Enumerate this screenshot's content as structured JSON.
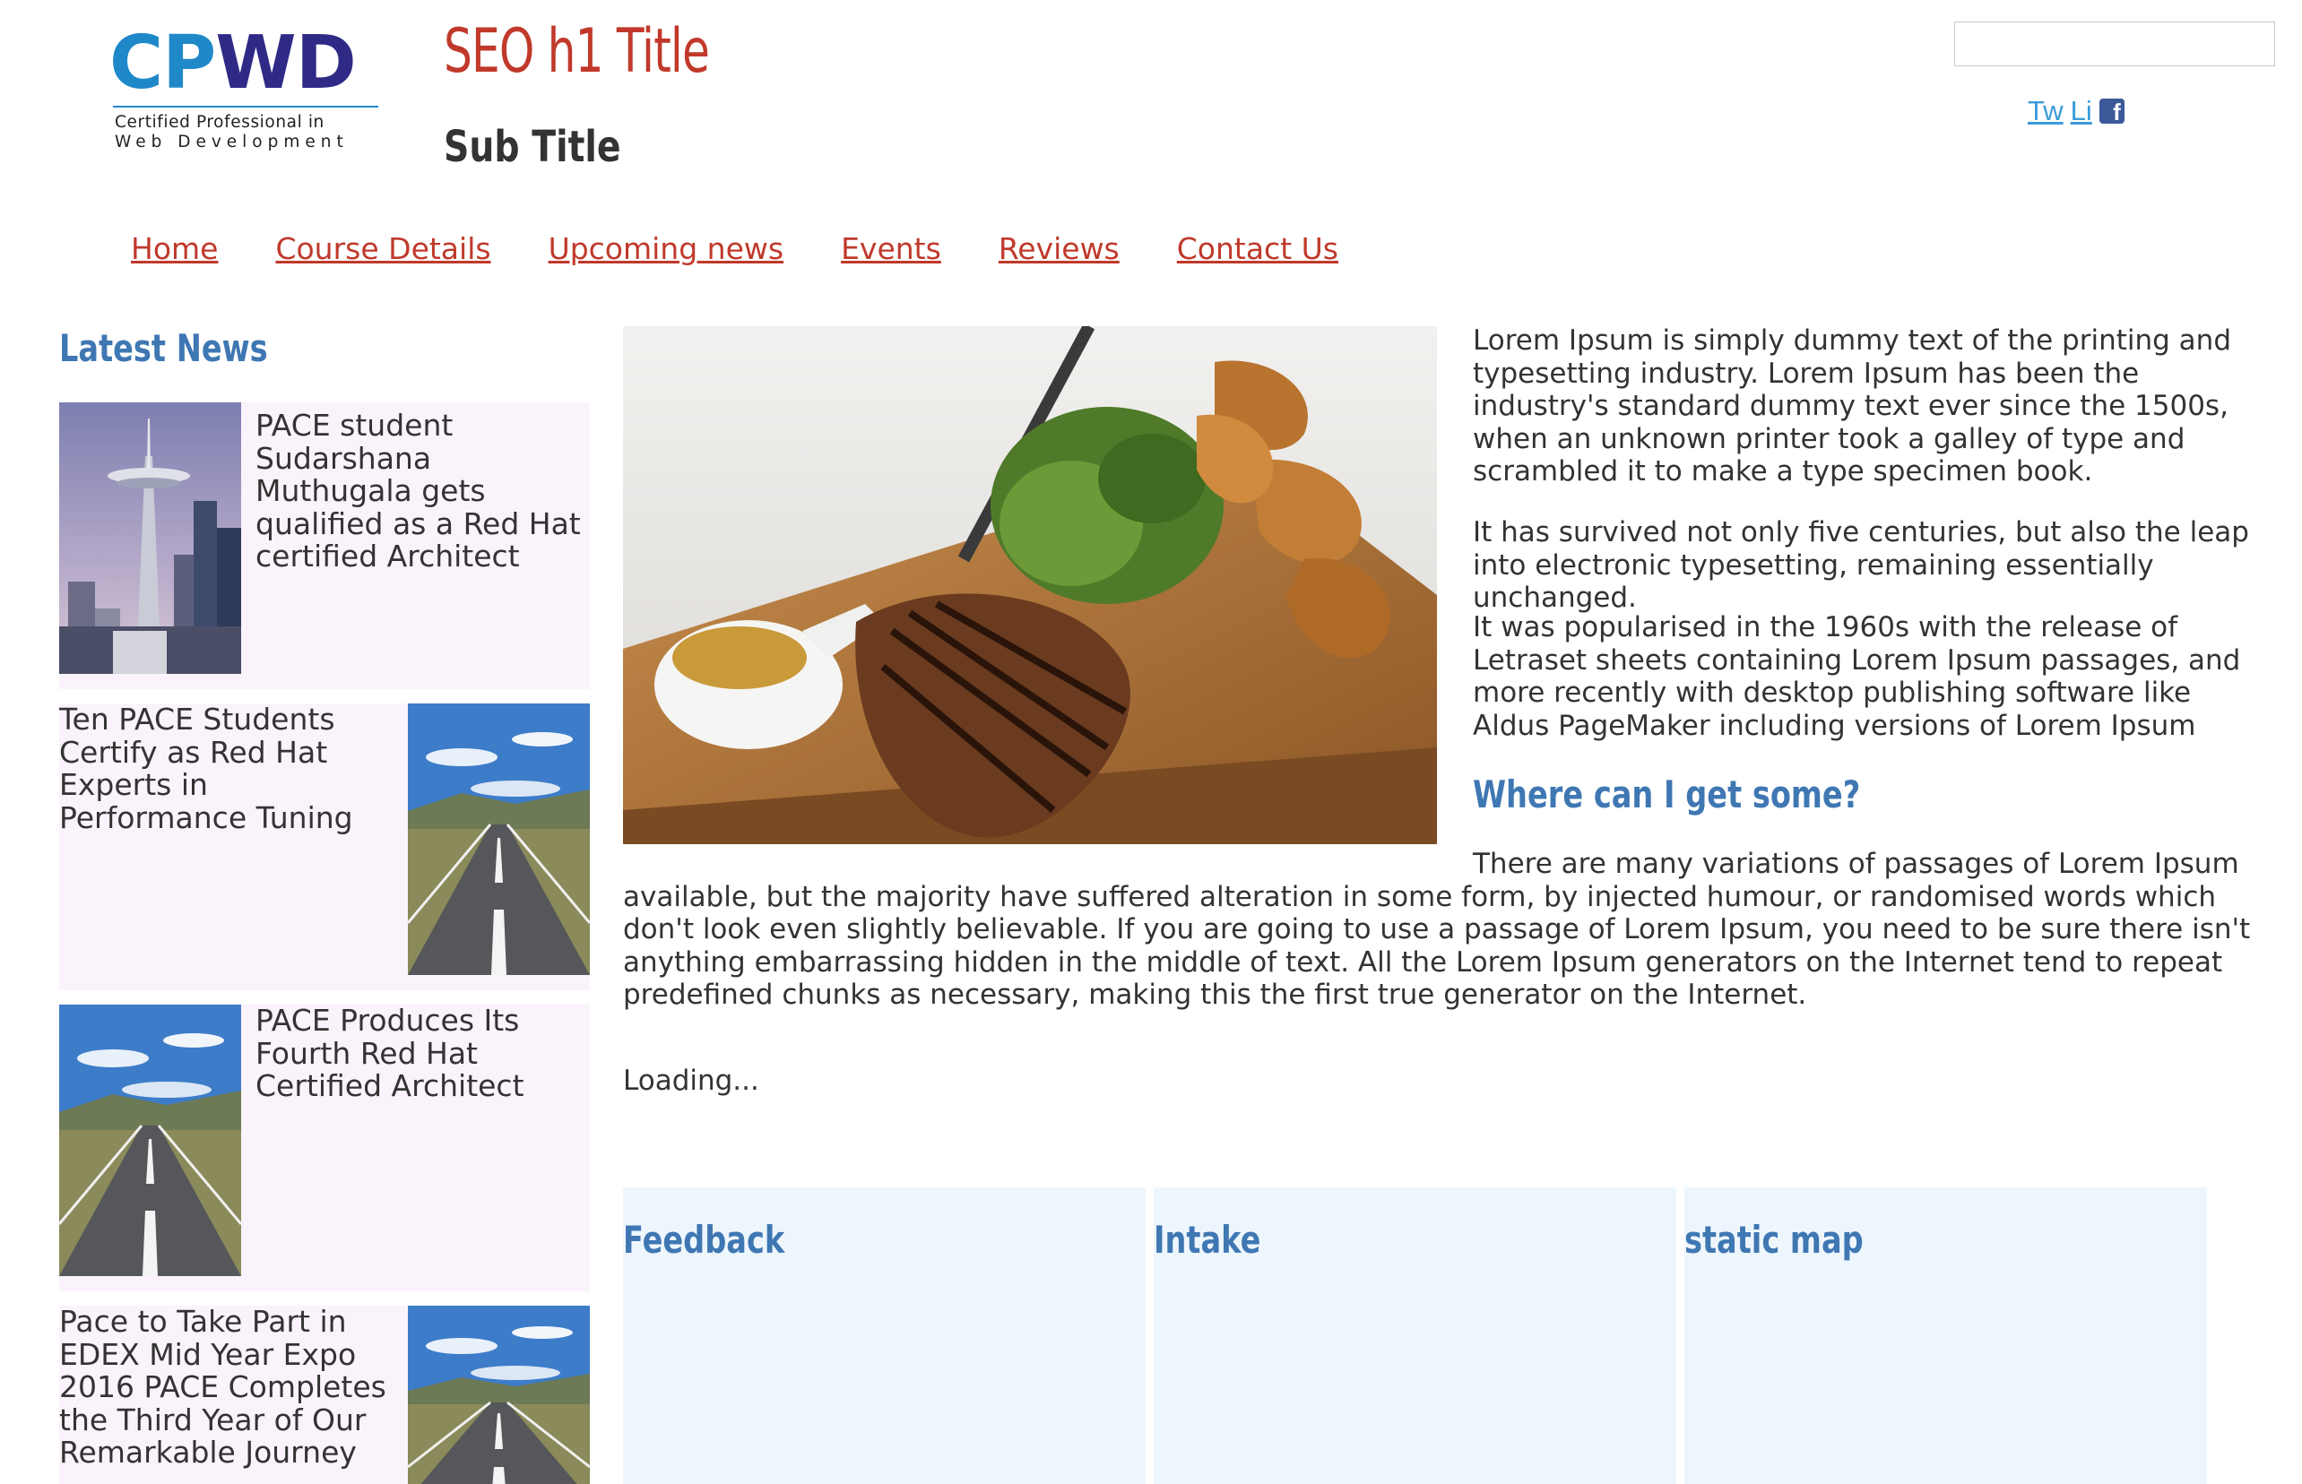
{
  "header": {
    "logo": {
      "part1": "CP",
      "part2": "WD",
      "tag_line1": "Certified Professional in",
      "tag_line2": "Web Development"
    },
    "h1_title": "SEO h1 Title",
    "sub_title": "Sub Title",
    "search": {
      "value": "",
      "placeholder": ""
    },
    "social": {
      "twitter": "Tw",
      "linkedin": "Li",
      "facebook": "f"
    }
  },
  "nav": [
    {
      "label": "Home"
    },
    {
      "label": "Course Details"
    },
    {
      "label": "Upcoming news"
    },
    {
      "label": "Events"
    },
    {
      "label": "Reviews"
    },
    {
      "label": "Contact Us"
    }
  ],
  "latest_news": {
    "heading": "Latest News",
    "items": [
      {
        "text": "PACE student Sudarshana Muthugala gets qualified as a Red Hat certified Architect",
        "image": "space-needle-photo"
      },
      {
        "text": "Ten PACE Students Certify as Red Hat Experts in Performance Tuning",
        "image": "road-photo"
      },
      {
        "text": "PACE Produces Its Fourth Red Hat Certified Architect",
        "image": "road-photo"
      },
      {
        "text": "Pace to Take Part in EDEX Mid Year Expo 2016 PACE Completes the Third Year of Our Remarkable Journey",
        "image": "road-photo"
      }
    ]
  },
  "main": {
    "hero_image": "steak-dinner-photo",
    "paragraphs": [
      "Lorem Ipsum is simply dummy text of the printing and typesetting industry. Lorem Ipsum has been the industry's standard dummy text ever since the 1500s, when an unknown printer took a galley of type and scrambled it to make a type specimen book.",
      "It has survived not only five centuries, but also the leap into electronic typesetting, remaining essentially unchanged.",
      "It was popularised in the 1960s with the release of Letraset sheets containing Lorem Ipsum passages, and more recently with desktop publishing software like Aldus PageMaker including versions of Lorem Ipsum"
    ],
    "where_heading": "Where can I get some?",
    "where_text": "There are many variations of passages of Lorem Ipsum available, but the majority have suffered alteration in some form, by injected humour, or randomised words which don't look even slightly believable. If you are going to use a passage of Lorem Ipsum, you need to be sure there isn't anything embarrassing hidden in the middle of text. All the Lorem Ipsum generators on the Internet tend to repeat predefined chunks as necessary, making this the first true generator on the Internet.",
    "loading": "Loading..."
  },
  "panels": [
    {
      "title": "Feedback"
    },
    {
      "title": "Intake"
    },
    {
      "title": "static map"
    }
  ],
  "colors": {
    "brand_red": "#c0392b",
    "heading_blue": "#3f77b3",
    "link_blue": "#3a9ad9",
    "news_bg": "#fbf3fb",
    "panel_bg": "#eef6fd",
    "logo_cyan": "#1f88c8",
    "logo_navy": "#2f2a86"
  }
}
